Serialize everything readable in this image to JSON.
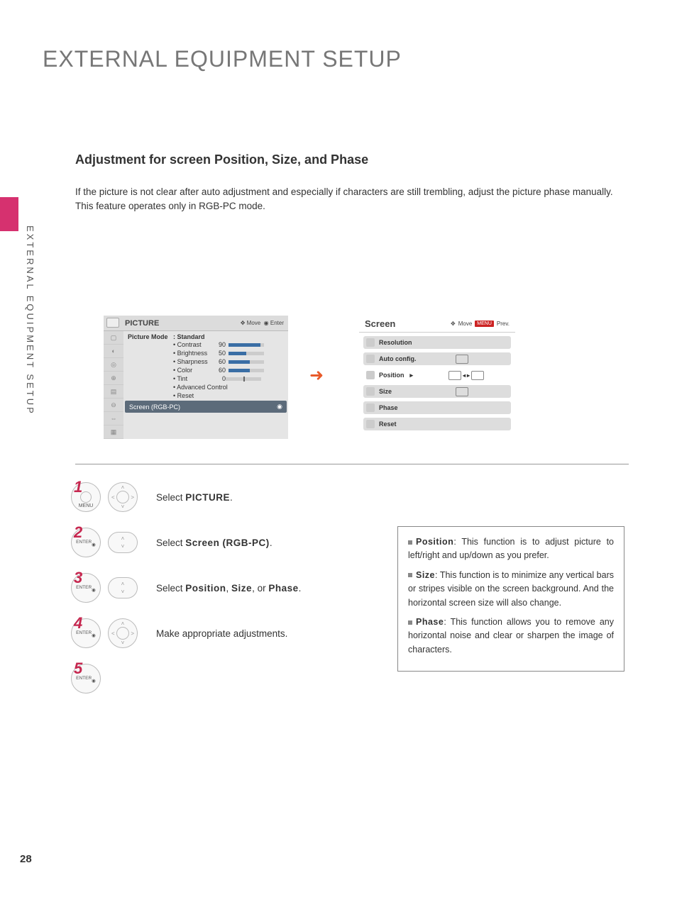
{
  "page": {
    "title": "EXTERNAL EQUIPMENT SETUP",
    "side_label": "EXTERNAL EQUIPMENT SETUP",
    "number": "28"
  },
  "section": {
    "subtitle": "Adjustment for screen Position, Size, and Phase",
    "intro_line1": "If the picture is not clear after auto adjustment and especially if characters are still trembling, adjust the picture phase manually.",
    "intro_line2": "This feature operates only in RGB-PC mode."
  },
  "osd_picture": {
    "title": "PICTURE",
    "hint_move": "Move",
    "hint_enter": "Enter",
    "mode_label": "Picture Mode",
    "mode_value": ": Standard",
    "items": [
      {
        "label": "• Contrast",
        "value": "90",
        "pct": 90
      },
      {
        "label": "• Brightness",
        "value": "50",
        "pct": 50
      },
      {
        "label": "• Sharpness",
        "value": "60",
        "pct": 60
      },
      {
        "label": "• Color",
        "value": "60",
        "pct": 60
      }
    ],
    "tint_label": "• Tint",
    "tint_value": "0",
    "adv": "• Advanced Control",
    "reset": "• Reset",
    "selected": "Screen (RGB-PC)"
  },
  "osd_screen": {
    "title": "Screen",
    "hint_move": "Move",
    "hint_prev": "Prev.",
    "menu_badge": "MENU",
    "items": [
      "Resolution",
      "Auto config.",
      "Position",
      "Size",
      "Phase",
      "Reset"
    ],
    "selected_index": 2
  },
  "steps": [
    {
      "num": "1",
      "btn1": "MENU",
      "btn2": "disc",
      "text_pre": "Select ",
      "bold": "PICTURE",
      "text_post": "."
    },
    {
      "num": "2",
      "btn1": "ENTER",
      "btn2": "ud",
      "text_pre": "Select ",
      "bold": "Screen (RGB-PC)",
      "text_post": "."
    },
    {
      "num": "3",
      "btn1": "ENTER",
      "btn2": "ud",
      "text_pre": "Select ",
      "bold": "Position",
      "text_mid": ", ",
      "bold2": "Size",
      "text_mid2": ", or ",
      "bold3": "Phase",
      "text_post": "."
    },
    {
      "num": "4",
      "btn1": "ENTER",
      "btn2": "disc",
      "text_pre": "Make appropriate adjustments.",
      "bold": ""
    },
    {
      "num": "5",
      "btn1": "ENTER",
      "btn2": "",
      "text_pre": "",
      "bold": ""
    }
  ],
  "info": {
    "p1_bold": "Position",
    "p1": ": This function is to adjust picture to left/right and up/down as you prefer.",
    "p2_bold": "Size",
    "p2": ": This function is to minimize any vertical bars or stripes visible on the screen background. And the horizontal screen size will also change.",
    "p3_bold": "Phase",
    "p3": ": This function allows you to remove any horizontal noise and clear or sharpen the image of characters."
  }
}
